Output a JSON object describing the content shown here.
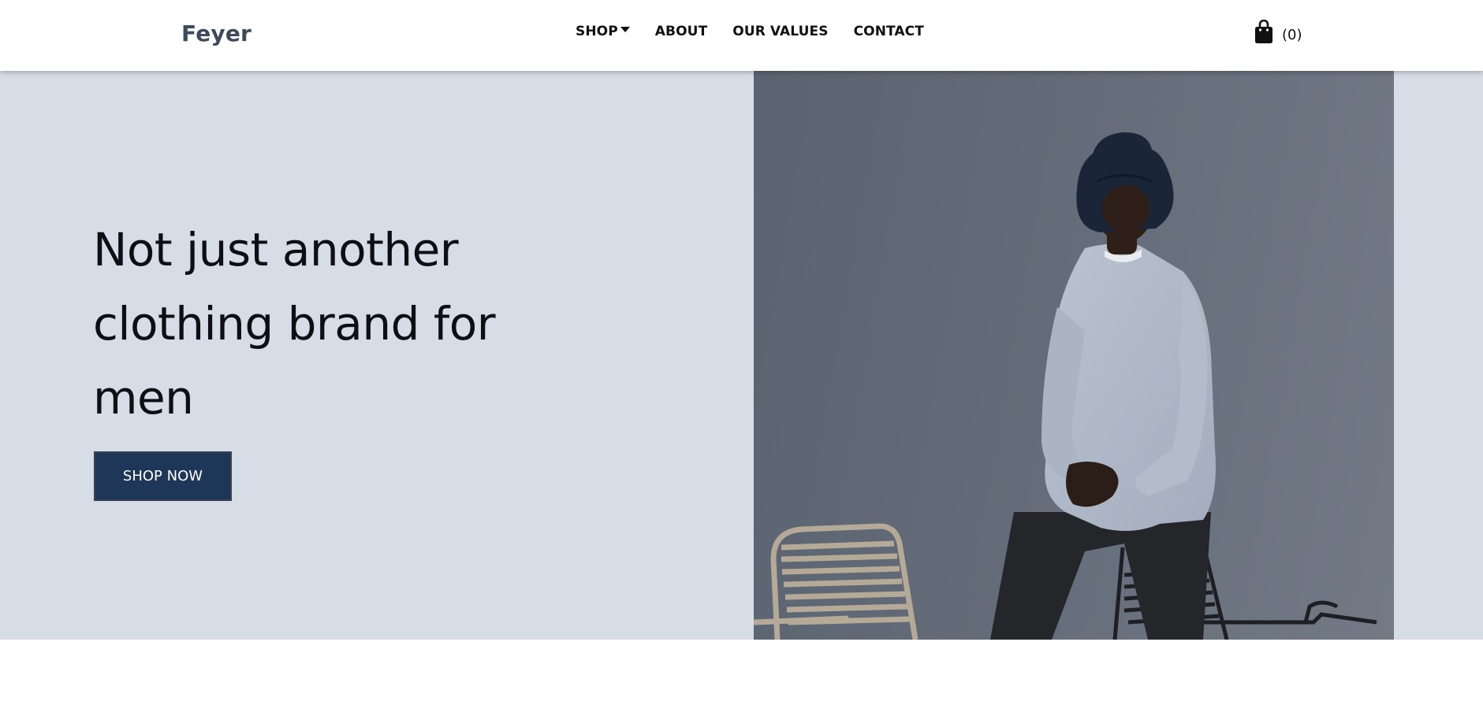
{
  "header": {
    "logo": "Feyer",
    "nav": [
      {
        "label": "SHOP",
        "has_dropdown": true
      },
      {
        "label": "ABOUT"
      },
      {
        "label": "OUR VALUES"
      },
      {
        "label": "CONTACT"
      }
    ],
    "cart": {
      "icon": "shopping-bag-icon",
      "count_label": "(0)"
    }
  },
  "hero": {
    "title": "Not just another clothing brand for men",
    "cta_label": "SHOP NOW",
    "image": "man-in-bucket-hat-sitting-on-chair-photo"
  },
  "colors": {
    "header_bg": "#ffffff",
    "hero_bg": "#d6dde6",
    "cta_bg": "#1e3657",
    "logo": "#3d4a5c",
    "text": "#111111"
  }
}
